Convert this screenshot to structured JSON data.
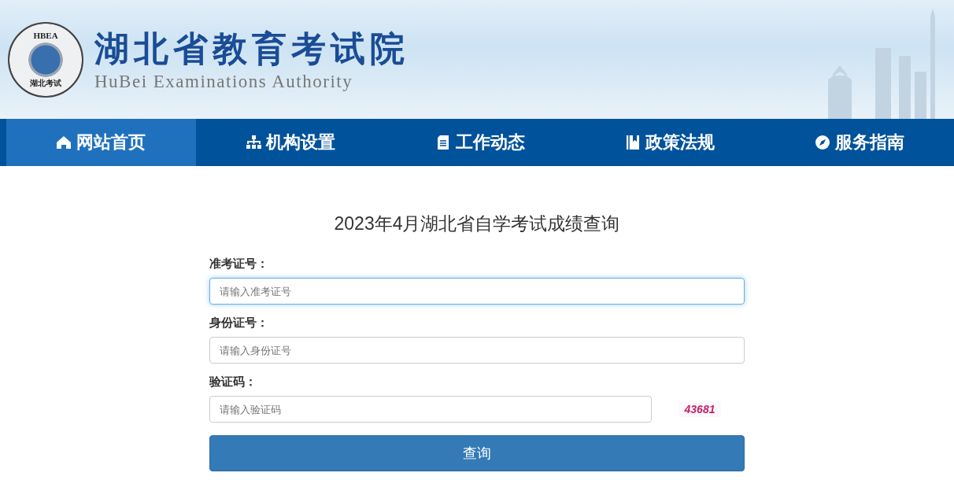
{
  "header": {
    "logo_top": "HBEA",
    "logo_bottom": "湖北考试",
    "title": "湖北省教育考试院",
    "subtitle": "HuBei Examinations Authority"
  },
  "nav": [
    {
      "label": "网站首页",
      "kind": "home",
      "selected": true
    },
    {
      "label": "机构设置",
      "kind": "org",
      "selected": false
    },
    {
      "label": "工作动态",
      "kind": "doc",
      "selected": false
    },
    {
      "label": "政策法规",
      "kind": "book",
      "selected": false
    },
    {
      "label": "服务指南",
      "kind": "compass",
      "selected": false
    }
  ],
  "form": {
    "title": "2023年4月湖北省自学考试成绩查询",
    "fields": [
      {
        "label": "准考证号：",
        "placeholder": "请输入准考证号",
        "focused": true
      },
      {
        "label": "身份证号：",
        "placeholder": "请输入身份证号",
        "focused": false
      },
      {
        "label": "验证码：",
        "placeholder": "请输入验证码",
        "focused": false,
        "captcha": "43681"
      }
    ],
    "submit": "查询"
  }
}
